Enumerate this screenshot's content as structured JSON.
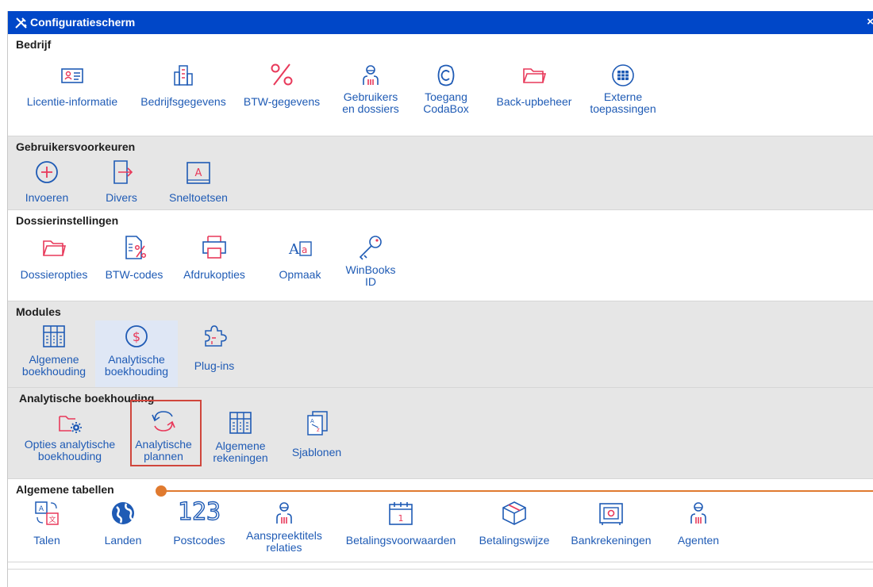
{
  "window": {
    "title": "Configuratiescherm",
    "close_label": "×"
  },
  "colors": {
    "titlebar": "#0047c8",
    "link": "#1f5bb5",
    "accent": "#e8395a",
    "highlight": "#d0463c",
    "callout": "#e07a2f"
  },
  "sections": {
    "bedrijf": {
      "title": "Bedrijf",
      "items": {
        "licentie": {
          "label": "Licentie-informatie",
          "icon": "id-card-icon"
        },
        "bedrijfsgegevens": {
          "label": "Bedrijfsgegevens",
          "icon": "building-icon"
        },
        "btw": {
          "label": "BTW-gegevens",
          "icon": "percent-icon"
        },
        "gebruikers": {
          "label1": "Gebruikers",
          "label2": "en dossiers",
          "icon": "users-icon"
        },
        "codabox": {
          "label1": "Toegang",
          "label2": "CodaBox",
          "icon": "codabox-icon"
        },
        "backup": {
          "label": "Back-upbeheer",
          "icon": "folder-icon"
        },
        "externe": {
          "label1": "Externe",
          "label2": "toepassingen",
          "icon": "apps-grid-icon"
        }
      }
    },
    "gebruikersvoorkeuren": {
      "title": "Gebruikersvoorkeuren",
      "items": {
        "invoeren": {
          "label": "Invoeren",
          "icon": "plus-circle-icon"
        },
        "divers": {
          "label": "Divers",
          "icon": "door-arrow-icon"
        },
        "sneltoetsen": {
          "label": "Sneltoetsen",
          "icon": "keyboard-key-icon"
        }
      }
    },
    "dossierinstellingen": {
      "title": "Dossierinstellingen",
      "items": {
        "dossieropties": {
          "label": "Dossieropties",
          "icon": "folder-icon"
        },
        "btwcodes": {
          "label": "BTW-codes",
          "icon": "percent-document-icon"
        },
        "afdrukopties": {
          "label": "Afdrukopties",
          "icon": "printer-icon"
        },
        "opmaak": {
          "label": "Opmaak",
          "icon": "font-icon"
        },
        "winbooksid": {
          "label1": "WinBooks",
          "label2": "ID",
          "icon": "key-icon"
        }
      }
    },
    "modules": {
      "title": "Modules",
      "items": {
        "algemene": {
          "label1": "Algemene",
          "label2": "boekhouding",
          "icon": "ledger-icon"
        },
        "analytische": {
          "label1": "Analytische",
          "label2": "boekhouding",
          "icon": "dollar-circle-icon"
        },
        "plugins": {
          "label": "Plug-ins",
          "icon": "puzzle-icon"
        }
      }
    },
    "analytische_boekhouding": {
      "title": "Analytische boekhouding",
      "items": {
        "opties": {
          "label1": "Opties analytische",
          "label2": "boekhouding",
          "icon": "folder-gear-icon"
        },
        "plannen": {
          "label1": "Analytische",
          "label2": "plannen",
          "icon": "refresh-arrows-icon"
        },
        "rekeningen": {
          "label1": "Algemene",
          "label2": "rekeningen",
          "icon": "ledger-icon"
        },
        "sjablonen": {
          "label": "Sjablonen",
          "icon": "sort-az-icon"
        }
      }
    },
    "algemene_tabellen": {
      "title": "Algemene tabellen",
      "items": {
        "talen": {
          "label": "Talen",
          "icon": "translate-icon"
        },
        "landen": {
          "label": "Landen",
          "icon": "globe-icon"
        },
        "postcodes": {
          "label": "Postcodes",
          "icon": "numbers-123-icon",
          "glyph": "123"
        },
        "aanspreektitels": {
          "label1": "Aanspreektitels",
          "label2": "relaties",
          "icon": "users-icon"
        },
        "betalingsvoorwaarden": {
          "label": "Betalingsvoorwaarden",
          "icon": "calendar-icon"
        },
        "betalingswijze": {
          "label": "Betalingswijze",
          "icon": "package-icon"
        },
        "bankrekeningen": {
          "label": "Bankrekeningen",
          "icon": "safe-icon"
        },
        "agenten": {
          "label": "Agenten",
          "icon": "user-icon"
        }
      }
    }
  }
}
